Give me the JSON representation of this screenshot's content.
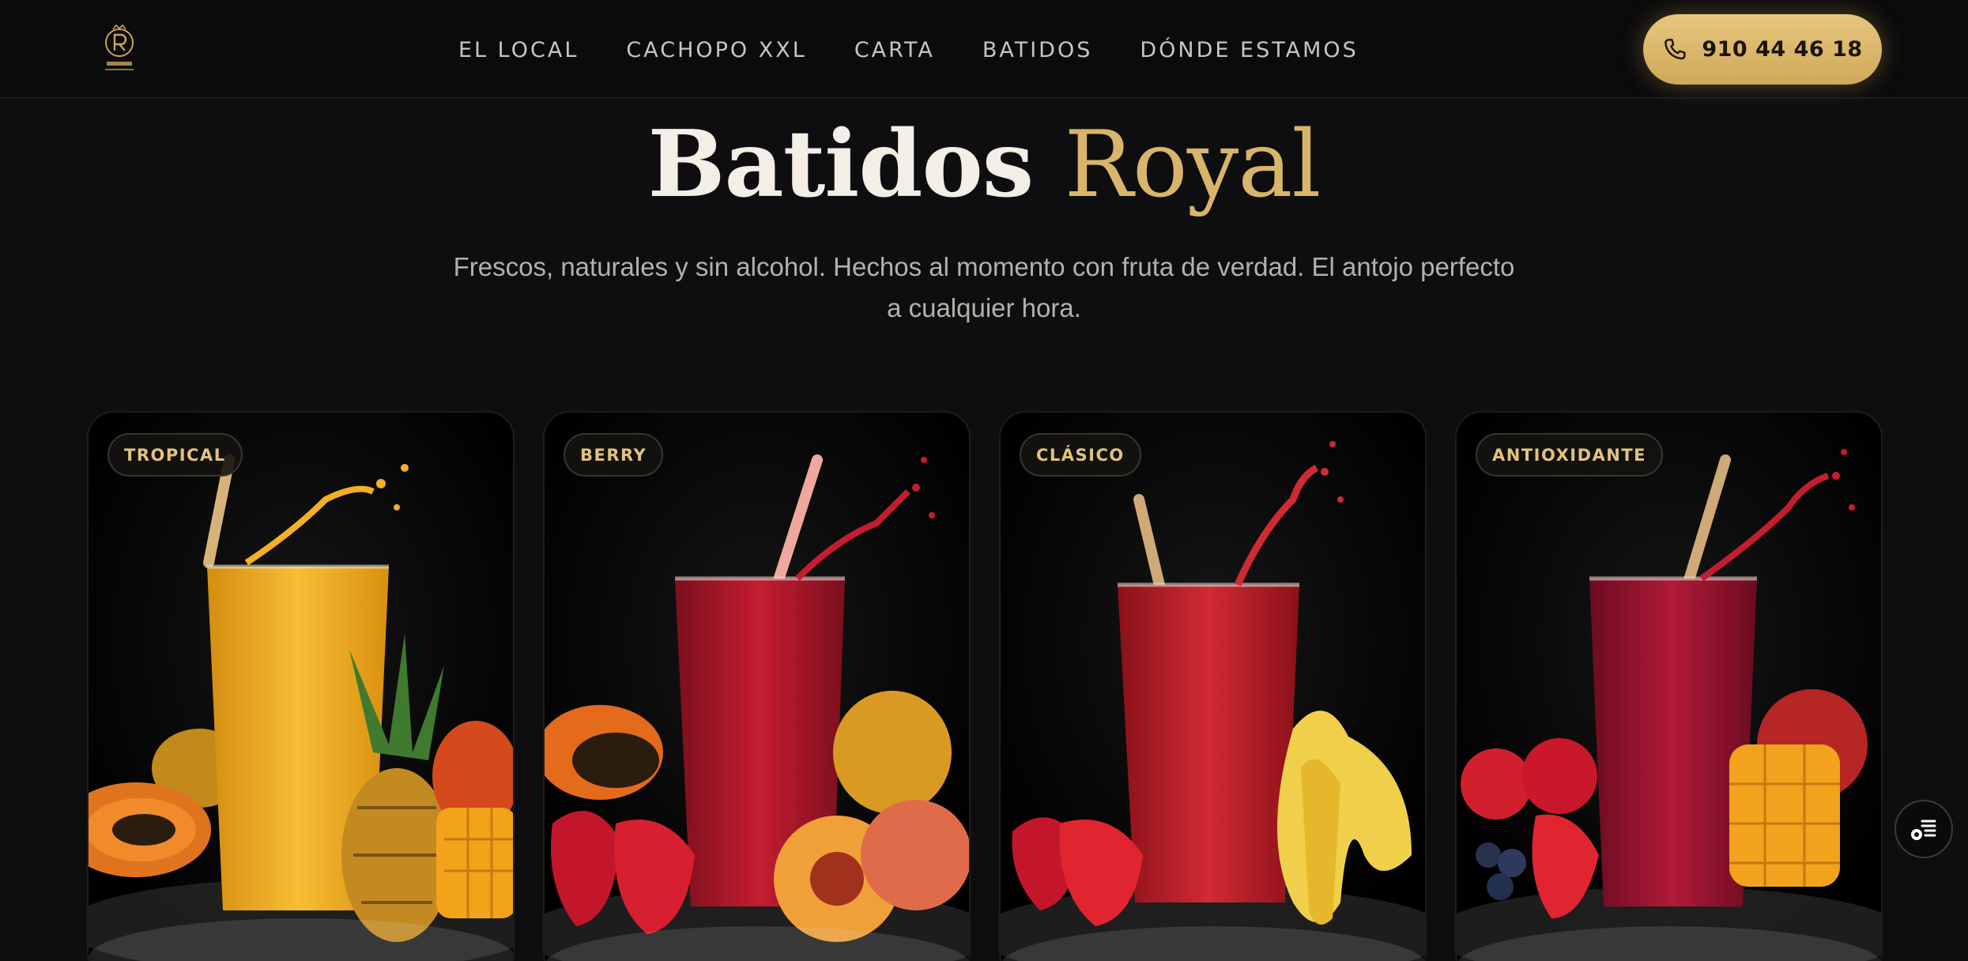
{
  "progress": {
    "value_pct": 59.5
  },
  "header": {
    "logo_text": "ROYAL",
    "nav": [
      "EL LOCAL",
      "CACHOPO XXL",
      "CARTA",
      "BATIDOS",
      "DÓNDE ESTAMOS"
    ],
    "phone": "910 44 46 18"
  },
  "hero": {
    "title_white": "Batidos",
    "title_gold": "Royal",
    "subtitle": "Frescos, naturales y sin alcohol. Hechos al momento con fruta de verdad. El antojo perfecto a cualquier hora."
  },
  "cards": [
    {
      "badge": "TROPICAL",
      "drink_color": "#f0b224",
      "fruit": "pineapple-papaya-mango"
    },
    {
      "badge": "BERRY",
      "drink_color": "#b3182a",
      "fruit": "papaya-strawberry-peach"
    },
    {
      "badge": "CLÁSICO",
      "drink_color": "#c7242d",
      "fruit": "strawberry-banana"
    },
    {
      "badge": "ANTIOXIDANTE",
      "drink_color": "#9e1530",
      "fruit": "strawberry-blueberry-mango"
    }
  ],
  "colors": {
    "accent_gold": "#d9b56a",
    "background": "#0e0e10"
  },
  "icons": {
    "phone": "phone-icon",
    "fab": "accessibility-menu-icon"
  }
}
